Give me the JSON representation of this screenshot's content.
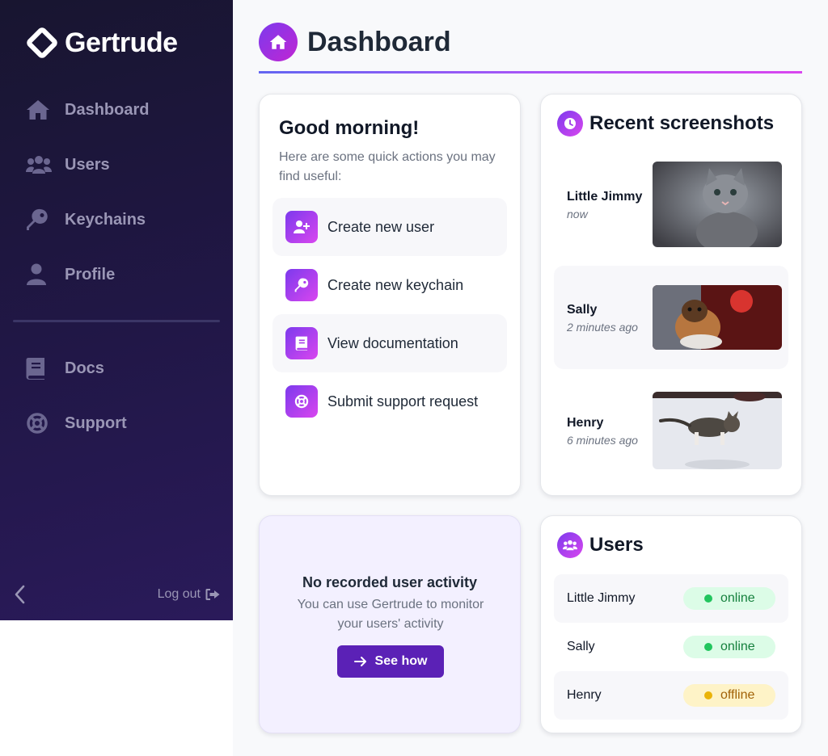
{
  "brand": {
    "name": "Gertrude"
  },
  "sidebar": {
    "items": [
      {
        "label": "Dashboard",
        "icon": "home-icon"
      },
      {
        "label": "Users",
        "icon": "users-icon"
      },
      {
        "label": "Keychains",
        "icon": "key-icon"
      },
      {
        "label": "Profile",
        "icon": "user-icon"
      },
      {
        "label": "Docs",
        "icon": "book-icon"
      },
      {
        "label": "Support",
        "icon": "lifebuoy-icon"
      }
    ],
    "collapse_icon": "chevron-left-icon",
    "logout_label": "Log out",
    "logout_icon": "sign-out-icon"
  },
  "header": {
    "title": "Dashboard",
    "icon": "home-icon"
  },
  "quick_actions": {
    "title": "Good morning!",
    "subtitle": "Here are some quick actions you may find useful:",
    "items": [
      {
        "label": "Create new user",
        "icon": "user-plus-icon"
      },
      {
        "label": "Create new keychain",
        "icon": "key-icon"
      },
      {
        "label": "View documentation",
        "icon": "book-icon"
      },
      {
        "label": "Submit support request",
        "icon": "lifebuoy-icon"
      }
    ]
  },
  "screenshots": {
    "title": "Recent screenshots",
    "icon": "clock-icon",
    "items": [
      {
        "name": "Little Jimmy",
        "time": "now"
      },
      {
        "name": "Sally",
        "time": "2 minutes ago"
      },
      {
        "name": "Henry",
        "time": "6 minutes ago"
      }
    ]
  },
  "activity": {
    "title": "No recorded user activity",
    "subtitle": "You can use Gertrude to monitor your users' activity",
    "button_label": "See how",
    "button_icon": "arrow-right-icon"
  },
  "users": {
    "title": "Users",
    "icon": "users-icon",
    "items": [
      {
        "name": "Little Jimmy",
        "status": "online"
      },
      {
        "name": "Sally",
        "status": "online"
      },
      {
        "name": "Henry",
        "status": "offline"
      }
    ]
  },
  "colors": {
    "sidebar_bg": "#1e1740",
    "accent_start": "#7c3aed",
    "accent_end": "#d946ef",
    "button": "#5b21b6",
    "online_bg": "#dcfce7",
    "online_dot": "#22c55e",
    "online_text": "#15803d",
    "offline_bg": "#fef3c7",
    "offline_dot": "#eab308",
    "offline_text": "#a16207"
  }
}
